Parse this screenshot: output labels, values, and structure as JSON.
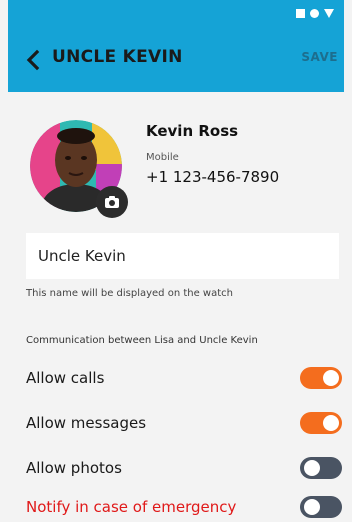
{
  "header": {
    "title": "UNCLE KEVIN",
    "save_label": "SAVE"
  },
  "contact": {
    "name": "Kevin Ross",
    "phone_type": "Mobile",
    "phone": "+1 123-456-7890"
  },
  "display_name": {
    "value": "Uncle Kevin",
    "hint": "This name will be displayed on the watch"
  },
  "permissions": {
    "section_label": "Communication between Lisa and Uncle Kevin",
    "items": [
      {
        "label": "Allow calls",
        "enabled": true
      },
      {
        "label": "Allow messages",
        "enabled": true
      },
      {
        "label": "Allow photos",
        "enabled": false
      },
      {
        "label": "Notify in case of emergency",
        "enabled": false
      }
    ]
  },
  "colors": {
    "header_bg": "#15a3d6",
    "toggle_on": "#f46d1e",
    "toggle_off": "#4a5463",
    "danger_text": "#e01919"
  }
}
